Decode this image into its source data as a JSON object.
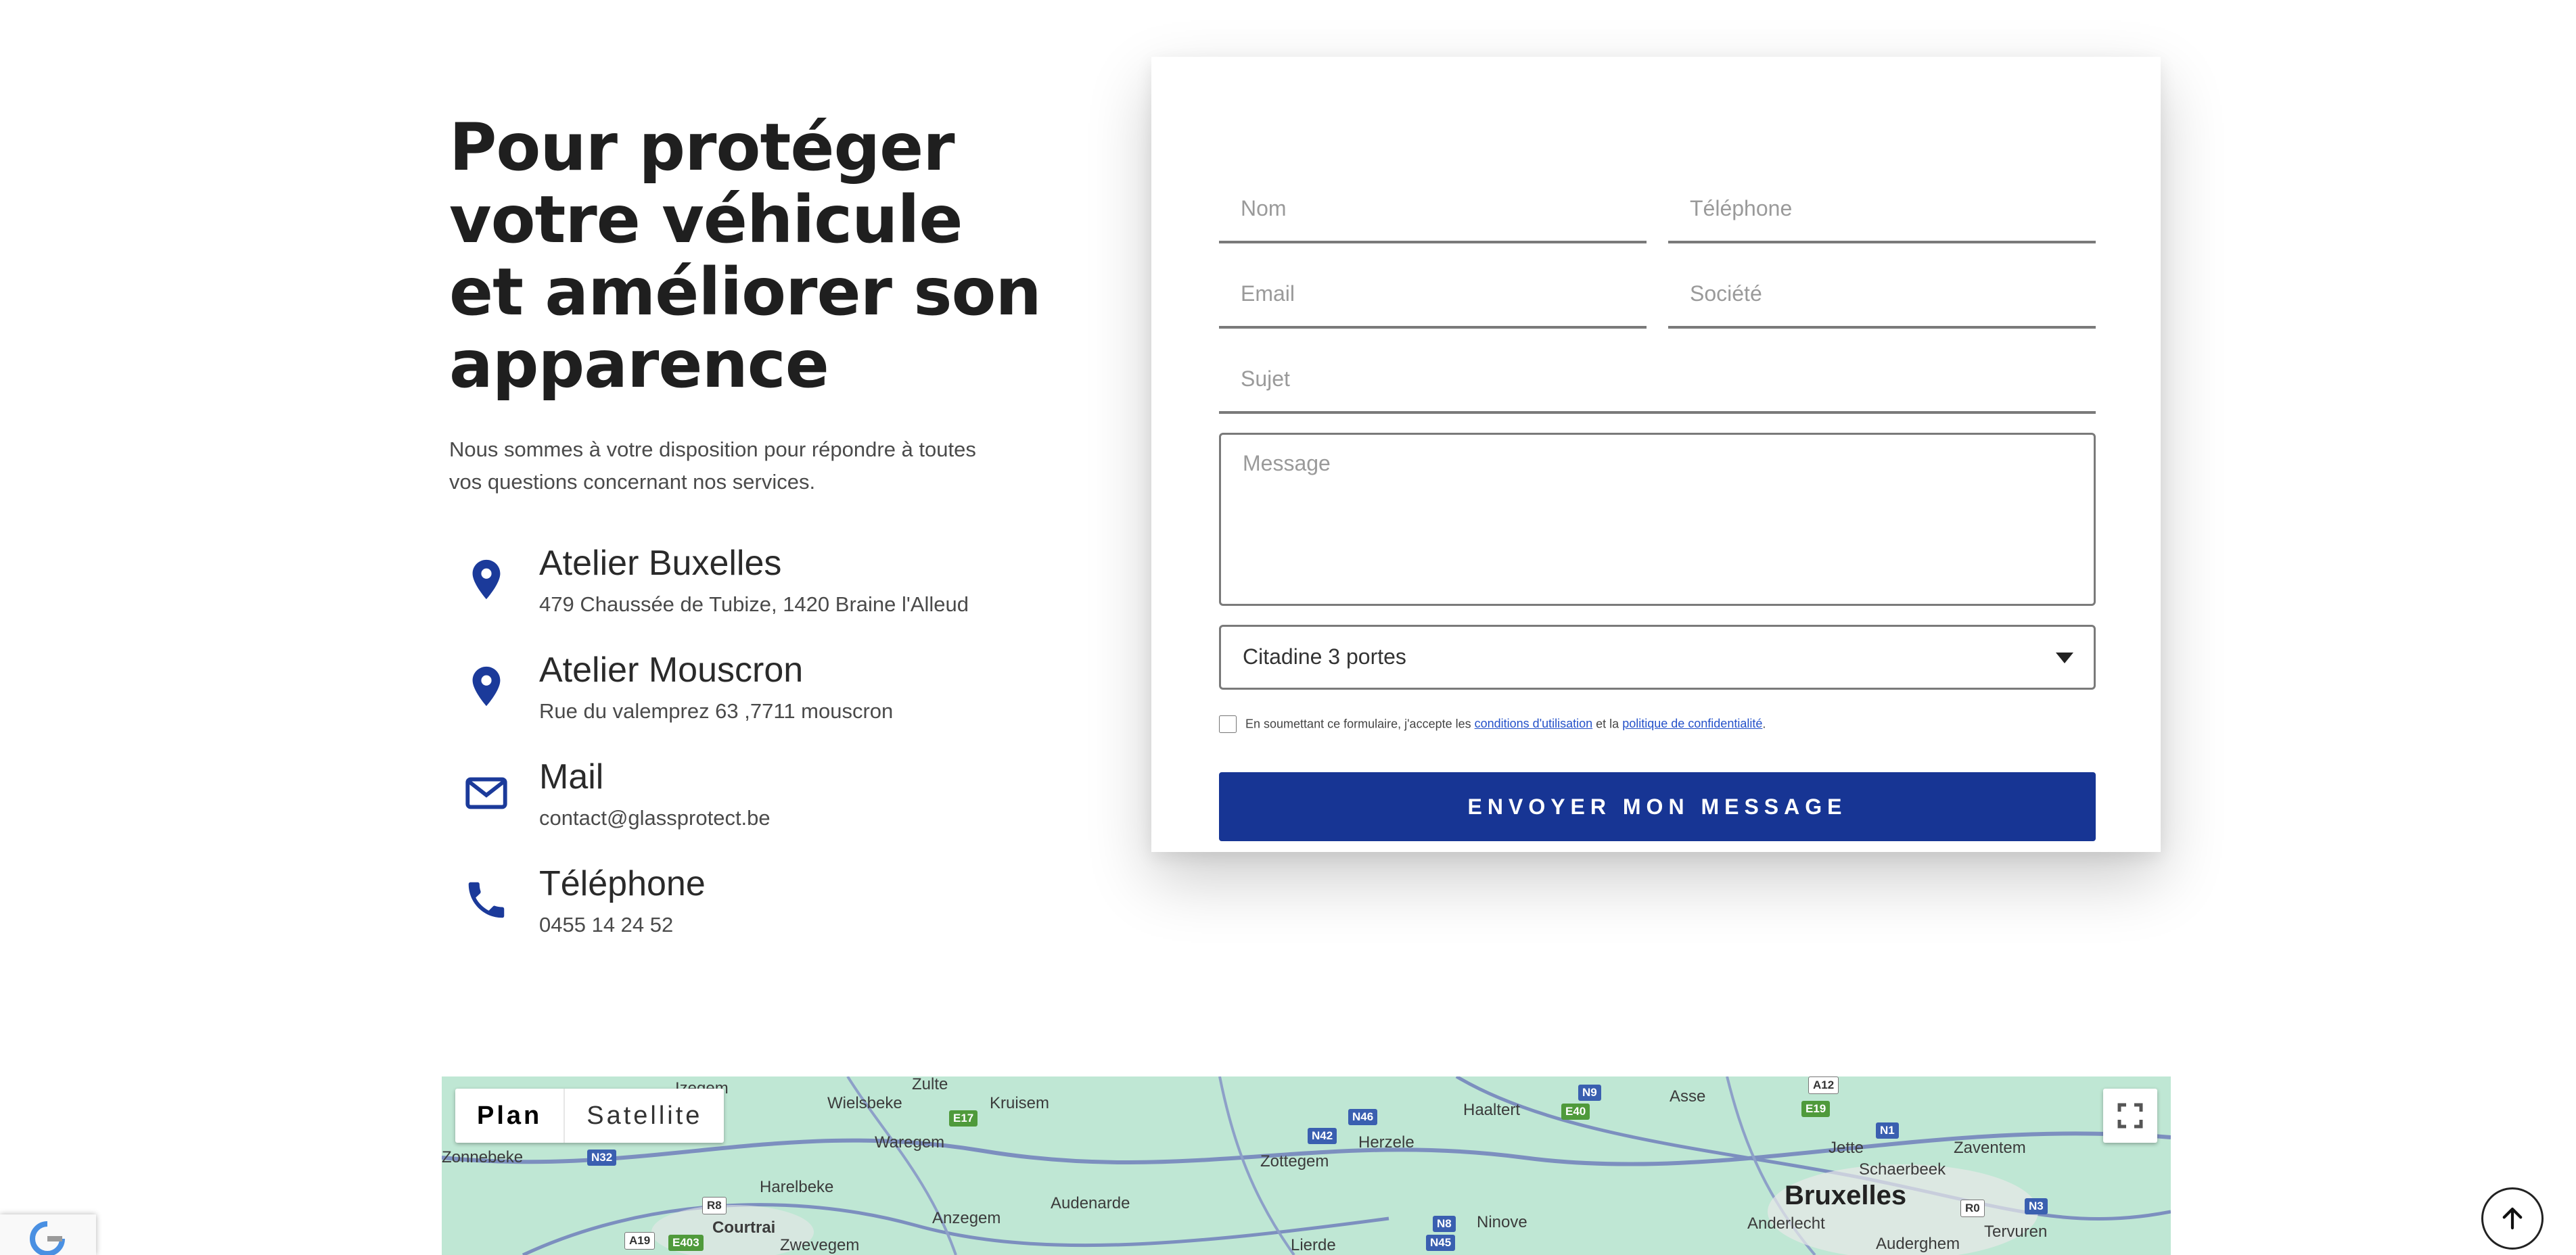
{
  "intro": {
    "headline": "Pour protéger votre véhicule et améliorer son apparence",
    "lede": "Nous sommes à votre disposition pour répondre à toutes vos questions concernant nos services."
  },
  "contacts": [
    {
      "icon": "location-pin-icon",
      "title": "Atelier Buxelles",
      "detail": "479 Chaussée de Tubize, 1420 Braine l'Alleud"
    },
    {
      "icon": "location-pin-icon",
      "title": "Atelier Mouscron",
      "detail": "Rue du valemprez 63 ,7711 mouscron"
    },
    {
      "icon": "envelope-icon",
      "title": "Mail",
      "detail": "contact@glassprotect.be"
    },
    {
      "icon": "phone-icon",
      "title": "Téléphone",
      "detail": "0455 14 24 52"
    }
  ],
  "form": {
    "nom_placeholder": "Nom",
    "telephone_placeholder": "Téléphone",
    "email_placeholder": "Email",
    "societe_placeholder": "Société",
    "sujet_placeholder": "Sujet",
    "message_placeholder": "Message",
    "vehicle_select_value": "Citadine 3 portes",
    "consent_prefix": "En soumettant ce formulaire, j'accepte les ",
    "consent_link_terms": "conditions d'utilisation",
    "consent_middle": " et la ",
    "consent_link_privacy": "politique de confidentialité",
    "consent_suffix": ".",
    "submit_label": "ENVOYER MON MESSAGE"
  },
  "map": {
    "tab_plan": "Plan",
    "tab_satellite": "Satellite",
    "places": [
      "Izegem",
      "Zulte",
      "Wielsbeke",
      "Kruisem",
      "Haaltert",
      "Asse",
      "Zaventem",
      "Zonnebeke",
      "Waregem",
      "Herzele",
      "Zottegem",
      "Harelbeke",
      "Audenarde",
      "Ninove",
      "Schaerbeek",
      "Jette",
      "Bruxelles",
      "Courtrai",
      "Anzegem",
      "Zwevegem",
      "Lierde",
      "Anderlecht",
      "Auderghem",
      "Tervuren"
    ],
    "roads": [
      "N32",
      "E17",
      "N46",
      "N42",
      "N9",
      "E40",
      "A12",
      "E19",
      "N1",
      "R8",
      "A19",
      "E403",
      "N8",
      "N45",
      "R0",
      "N3"
    ]
  },
  "colors": {
    "accent": "#173594",
    "link": "#2451c9",
    "map_bg": "#bfe7d4"
  }
}
